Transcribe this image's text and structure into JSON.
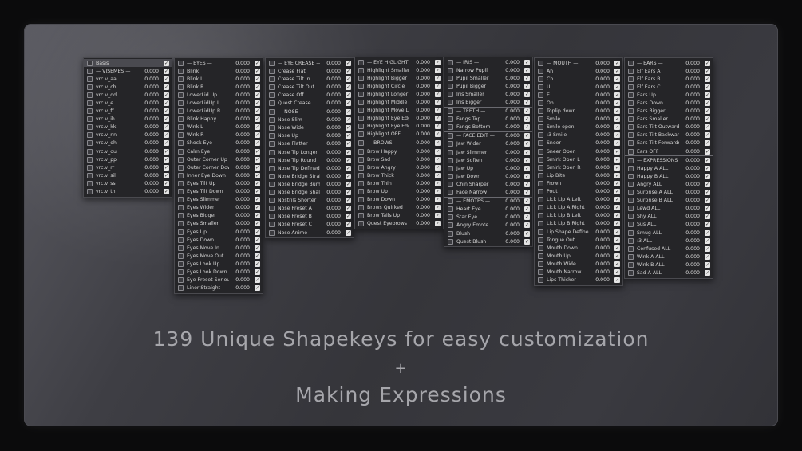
{
  "headline": {
    "line1": "139 Unique Shapekeys for easy customization",
    "line2": "+",
    "line3": "Making Expressions"
  },
  "colors": {
    "panel_bg": "#252528",
    "text": "#d4d4d4",
    "headline": "#a6a6ab",
    "checkbox": "#e6e6e6"
  },
  "icons": {
    "row_icon": "shapekey-icon",
    "checkbox": "checkbox-checked-icon"
  },
  "columns": [
    {
      "panels": [
        {
          "items": [
            {
              "label": "Basis",
              "value": "",
              "selected": true
            },
            {
              "label": "— VISEMES —",
              "value": "0.000"
            },
            {
              "label": "vrc.v_aa",
              "value": "0.000"
            },
            {
              "label": "vrc.v_ch",
              "value": "0.000"
            },
            {
              "label": "vrc.v_dd",
              "value": "0.000"
            },
            {
              "label": "vrc.v_e",
              "value": "0.000"
            },
            {
              "label": "vrc.v_ff",
              "value": "0.000"
            },
            {
              "label": "vrc.v_ih",
              "value": "0.000"
            },
            {
              "label": "vrc.v_kk",
              "value": "0.000"
            },
            {
              "label": "vrc.v_nn",
              "value": "0.000"
            },
            {
              "label": "vrc.v_oh",
              "value": "0.000"
            },
            {
              "label": "vrc.v_ou",
              "value": "0.000"
            },
            {
              "label": "vrc.v_pp",
              "value": "0.000"
            },
            {
              "label": "vrc.v_rr",
              "value": "0.000"
            },
            {
              "label": "vrc.v_sil",
              "value": "0.000"
            },
            {
              "label": "vrc.v_ss",
              "value": "0.000"
            },
            {
              "label": "vrc.v_th",
              "value": "0.000"
            }
          ]
        }
      ]
    },
    {
      "panels": [
        {
          "items": [
            {
              "label": "— EYES —",
              "value": "0.000"
            },
            {
              "label": "Blink",
              "value": "0.000"
            },
            {
              "label": "Blink L",
              "value": "0.000"
            },
            {
              "label": "Blink R",
              "value": "0.000"
            },
            {
              "label": "LowerLid Up",
              "value": "0.000"
            },
            {
              "label": "LowerLidUp L",
              "value": "0.000"
            },
            {
              "label": "LowerLidUp R",
              "value": "0.000"
            },
            {
              "label": "Blink Happy",
              "value": "0.000"
            },
            {
              "label": "Wink L",
              "value": "0.000"
            },
            {
              "label": "Wink R",
              "value": "0.000"
            },
            {
              "label": "Shock Eye",
              "value": "0.000"
            },
            {
              "label": "Calm Eye",
              "value": "0.000"
            },
            {
              "label": "Outer Corner Up",
              "value": "0.000"
            },
            {
              "label": "Outer Corner Down",
              "value": "0.000"
            },
            {
              "label": "Inner Eye Down",
              "value": "0.000"
            },
            {
              "label": "Eyes Tilt Up",
              "value": "0.000"
            },
            {
              "label": "Eyes Tilt Down",
              "value": "0.000"
            },
            {
              "label": "Eyes Slimmer",
              "value": "0.000"
            },
            {
              "label": "Eyes Wider",
              "value": "0.000"
            },
            {
              "label": "Eyes Bigger",
              "value": "0.000"
            },
            {
              "label": "Eyes Smaller",
              "value": "0.000"
            },
            {
              "label": "Eyes Up",
              "value": "0.000"
            },
            {
              "label": "Eyes Down",
              "value": "0.000"
            },
            {
              "label": "Eyes Move In",
              "value": "0.000"
            },
            {
              "label": "Eyes Move Out",
              "value": "0.000"
            },
            {
              "label": "Eyes Look Up",
              "value": "0.000"
            },
            {
              "label": "Eyes Look Down",
              "value": "0.000"
            },
            {
              "label": "Eye Preset Serious",
              "value": "0.000"
            },
            {
              "label": "Liner Straight",
              "value": "0.000"
            }
          ]
        }
      ]
    },
    {
      "panels": [
        {
          "items": [
            {
              "label": "— EYE CREASE —",
              "value": "0.000"
            },
            {
              "label": "Crease Flat",
              "value": "0.000"
            },
            {
              "label": "Crease Tilt In",
              "value": "0.000"
            },
            {
              "label": "Crease Tilt Out",
              "value": "0.000"
            },
            {
              "label": "Crease Off",
              "value": "0.000"
            },
            {
              "label": "Quest Crease",
              "value": "0.000"
            },
            {
              "label": "— NOSE —",
              "value": "0.000",
              "sep": true
            },
            {
              "label": "Nose Slim",
              "value": "0.000"
            },
            {
              "label": "Nose Wide",
              "value": "0.000"
            },
            {
              "label": "Nose Up",
              "value": "0.000"
            },
            {
              "label": "Nose Flatter",
              "value": "0.000"
            },
            {
              "label": "Nose Tip Longer",
              "value": "0.000"
            },
            {
              "label": "Nose Tip Round",
              "value": "0.000"
            },
            {
              "label": "Nose Tip Defined",
              "value": "0.000"
            },
            {
              "label": "Nose Bridge Straight",
              "value": "0.000"
            },
            {
              "label": "Nose Bridge Bump",
              "value": "0.000"
            },
            {
              "label": "Nose Bridge Shallow",
              "value": "0.000"
            },
            {
              "label": "Nostrils Shorter",
              "value": "0.000"
            },
            {
              "label": "Nose Preset A",
              "value": "0.000"
            },
            {
              "label": "Nose Preset B",
              "value": "0.000"
            },
            {
              "label": "Nose Preset C",
              "value": "0.000"
            },
            {
              "label": "Nose Anime",
              "value": "0.000"
            }
          ]
        }
      ]
    },
    {
      "panels": [
        {
          "items": [
            {
              "label": "— EYE HIGLIGHT —",
              "value": "0.000"
            },
            {
              "label": "Highlight Smaller",
              "value": "0.000"
            },
            {
              "label": "Highlight Bigger",
              "value": "0.000"
            },
            {
              "label": "Highlight Circle",
              "value": "0.000"
            },
            {
              "label": "Highlight Longer",
              "value": "0.000"
            },
            {
              "label": "Highlight Middle",
              "value": "0.000"
            },
            {
              "label": "Highlight Move Left",
              "value": "0.000"
            },
            {
              "label": "Highlight Eye Edge L",
              "value": "0.000"
            },
            {
              "label": "Highlight Eye Edge R",
              "value": "0.000"
            },
            {
              "label": "Highlight OFF",
              "value": "0.000"
            },
            {
              "label": "— BROWS —",
              "value": "0.000",
              "sep": true
            },
            {
              "label": "Brow Happy",
              "value": "0.000"
            },
            {
              "label": "Brow Sad",
              "value": "0.000"
            },
            {
              "label": "Brow Angry",
              "value": "0.000"
            },
            {
              "label": "Brow Thick",
              "value": "0.000"
            },
            {
              "label": "Brow Thin",
              "value": "0.000"
            },
            {
              "label": "Brow Up",
              "value": "0.000"
            },
            {
              "label": "Brow Down",
              "value": "0.000"
            },
            {
              "label": "Brows Quirked",
              "value": "0.000"
            },
            {
              "label": "Brow Tails Up",
              "value": "0.000"
            },
            {
              "label": "Quest Eyebrows",
              "value": "0.000"
            }
          ]
        }
      ]
    },
    {
      "panels": [
        {
          "items": [
            {
              "label": "— IRIS —",
              "value": "0.000"
            },
            {
              "label": "Narrow Pupil",
              "value": "0.000"
            },
            {
              "label": "Pupil Smaller",
              "value": "0.000"
            },
            {
              "label": "Pupil Bigger",
              "value": "0.000"
            },
            {
              "label": "Iris Smaller",
              "value": "0.000"
            },
            {
              "label": "Iris Bigger",
              "value": "0.000"
            },
            {
              "label": "— TEETH —",
              "value": "0.000",
              "sep": true
            },
            {
              "label": "Fangs Top",
              "value": "0.000"
            },
            {
              "label": "Fangs Bottom",
              "value": "0.000"
            },
            {
              "label": "— FACE EDIT —",
              "value": "0.000",
              "sep": true
            },
            {
              "label": "Jaw Wider",
              "value": "0.000"
            },
            {
              "label": "Jaw Slimmer",
              "value": "0.000"
            },
            {
              "label": "Jaw Soften",
              "value": "0.000"
            },
            {
              "label": "Jaw Up",
              "value": "0.000"
            },
            {
              "label": "Jaw Down",
              "value": "0.000"
            },
            {
              "label": "Chin Sharper",
              "value": "0.000"
            },
            {
              "label": "Face Narrow",
              "value": "0.000"
            },
            {
              "label": "— EMOTES —",
              "value": "0.000",
              "sep": true
            },
            {
              "label": "Heart Eye",
              "value": "0.000"
            },
            {
              "label": "Star Eye",
              "value": "0.000"
            },
            {
              "label": "Angry Emote",
              "value": "0.000"
            },
            {
              "label": "Blush",
              "value": "0.000"
            },
            {
              "label": "Quest Blush",
              "value": "0.000"
            }
          ]
        }
      ]
    },
    {
      "panels": [
        {
          "items": [
            {
              "label": "— MOUTH —",
              "value": "0.000"
            },
            {
              "label": "Ah",
              "value": "0.000"
            },
            {
              "label": "Ch",
              "value": "0.000"
            },
            {
              "label": "U",
              "value": "0.000"
            },
            {
              "label": "E",
              "value": "0.000"
            },
            {
              "label": "Oh",
              "value": "0.000"
            },
            {
              "label": "Toplip down",
              "value": "0.000"
            },
            {
              "label": "Smile",
              "value": "0.000"
            },
            {
              "label": "Smile open",
              "value": "0.000"
            },
            {
              "label": ":3 Smile",
              "value": "0.000"
            },
            {
              "label": "Sneer",
              "value": "0.000"
            },
            {
              "label": "Sneer Open",
              "value": "0.000"
            },
            {
              "label": "Smirk Open L",
              "value": "0.000"
            },
            {
              "label": "Smirk Open R",
              "value": "0.000"
            },
            {
              "label": "Lip Bite",
              "value": "0.000"
            },
            {
              "label": "Frown",
              "value": "0.000"
            },
            {
              "label": "Pout",
              "value": "0.000"
            },
            {
              "label": "Lick Lip A Left",
              "value": "0.000"
            },
            {
              "label": "Lick Lip A Right",
              "value": "0.000"
            },
            {
              "label": "Lick Lip B Left",
              "value": "0.000"
            },
            {
              "label": "Lick Lip B Right",
              "value": "0.000"
            },
            {
              "label": "Lip Shape Defined",
              "value": "0.000"
            },
            {
              "label": "Tongue Out",
              "value": "0.000"
            },
            {
              "label": "Mouth Down",
              "value": "0.000"
            },
            {
              "label": "Mouth Up",
              "value": "0.000"
            },
            {
              "label": "Mouth Wide",
              "value": "0.000"
            },
            {
              "label": "Mouth Narrow",
              "value": "0.000"
            },
            {
              "label": "Lips Thicker",
              "value": "0.000"
            }
          ]
        }
      ]
    },
    {
      "panels": [
        {
          "items": [
            {
              "label": "— EARS —",
              "value": "0.000"
            },
            {
              "label": "Elf Ears A",
              "value": "0.000"
            },
            {
              "label": "Elf Ears B",
              "value": "0.000"
            },
            {
              "label": "Elf Ears C",
              "value": "0.000"
            },
            {
              "label": "Ears Up",
              "value": "0.000"
            },
            {
              "label": "Ears Down",
              "value": "0.000"
            },
            {
              "label": "Ears Bigger",
              "value": "0.000"
            },
            {
              "label": "Ears Smaller",
              "value": "0.000"
            },
            {
              "label": "Ears Tilt Outwards",
              "value": "0.000"
            },
            {
              "label": "Ears Tilt Backwards",
              "value": "0.000"
            },
            {
              "label": "Ears Tilt Forwards",
              "value": "0.000"
            },
            {
              "label": "Ears OFF",
              "value": "0.000"
            },
            {
              "label": "— EXPRESSIONS —",
              "value": "0.000",
              "sep": true
            },
            {
              "label": "Happy A ALL",
              "value": "0.000"
            },
            {
              "label": "Happy B ALL",
              "value": "0.000"
            },
            {
              "label": "Angry ALL",
              "value": "0.000"
            },
            {
              "label": "Surprise A ALL",
              "value": "0.000"
            },
            {
              "label": "Surprise B ALL",
              "value": "0.000"
            },
            {
              "label": "Lewd ALL",
              "value": "0.000"
            },
            {
              "label": "Shy ALL",
              "value": "0.000"
            },
            {
              "label": "Sus ALL",
              "value": "0.000"
            },
            {
              "label": "Smug ALL",
              "value": "0.000"
            },
            {
              "label": ":3 ALL",
              "value": "0.000"
            },
            {
              "label": "Confused ALL",
              "value": "0.000"
            },
            {
              "label": "Wink A ALL",
              "value": "0.000"
            },
            {
              "label": "Wink B ALL",
              "value": "0.000"
            },
            {
              "label": "Sad A ALL",
              "value": "0.000"
            }
          ]
        }
      ]
    }
  ]
}
